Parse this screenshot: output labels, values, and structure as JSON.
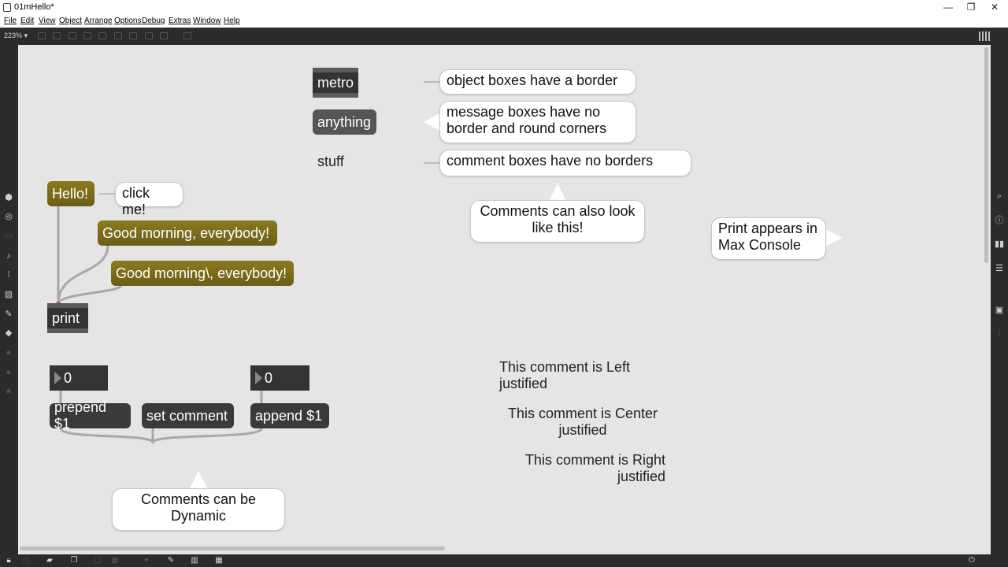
{
  "window": {
    "title": "01mHello*",
    "controls": {
      "minimize": "—",
      "restore": "❐",
      "close": "✕"
    }
  },
  "menu": [
    "File",
    "Edit",
    "View",
    "Object",
    "Arrange",
    "Options",
    "Debug",
    "Extras",
    "Window",
    "Help"
  ],
  "toolbar": {
    "zoom": "223% ▾"
  },
  "patch": {
    "objects": {
      "metro": "metro",
      "print": "print"
    },
    "messages": {
      "anything": "anything",
      "hello": "Hello!",
      "good_morning": "Good morning, everybody!",
      "good_morning_escaped": "Good morning\\, everybody!",
      "prepend": "prepend $1",
      "set_comment": "set comment",
      "append": "append $1"
    },
    "numbers": {
      "left": "0",
      "right": "0"
    },
    "comments": {
      "stuff": "stuff",
      "left_justified": "This comment is Left justified",
      "center_justified_line1": "This comment is Center",
      "center_justified_line2": "justified",
      "right_justified_line1": "This comment is Right",
      "right_justified_line2": "justified"
    },
    "bubbles": {
      "object_boxes": "object boxes have a border",
      "message_boxes": "message boxes have no border and round corners",
      "comment_boxes": "comment boxes have no borders",
      "comments_look": "Comments can also look like this!",
      "print_console": "Print appears in Max Console",
      "click_me": "click me!",
      "dynamic": "Comments can be Dynamic"
    }
  },
  "colors": {
    "canvas": "#e5e5e5",
    "object_box": "#333333",
    "message_box": "#555555",
    "message_yellow": "#7a6b1c",
    "chrome": "#2b2b2b"
  }
}
